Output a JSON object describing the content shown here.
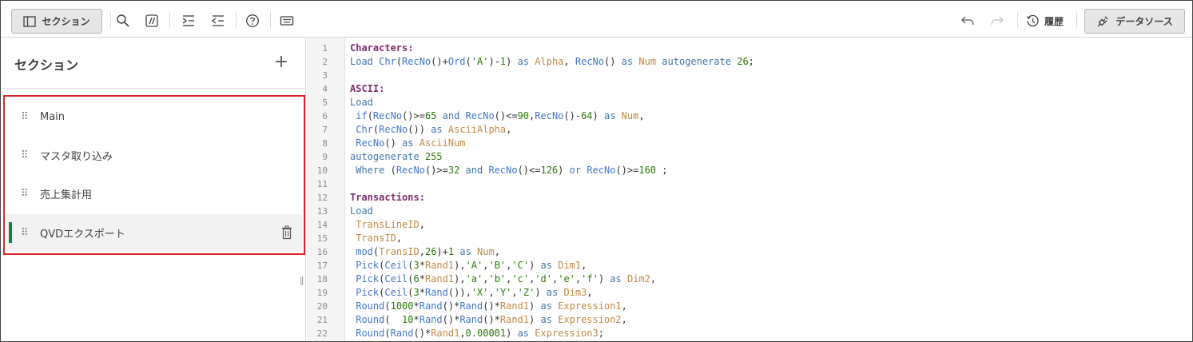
{
  "toolbar": {
    "sections_label": "セクション",
    "history_label": "履歴",
    "datasource_label": "データソース"
  },
  "left_panel": {
    "title": "セクション",
    "add_symbol": "+",
    "sections": [
      {
        "label": "Main"
      },
      {
        "label": "マスタ取り込み"
      },
      {
        "label": "売上集計用"
      },
      {
        "label": "QVDエクスポート",
        "active": true
      }
    ]
  },
  "editor": {
    "line_numbers": [
      "1",
      "2",
      "3",
      "4",
      "5",
      "6",
      "7",
      "8",
      "9",
      "10",
      "11",
      "12",
      "13",
      "14",
      "15",
      "16",
      "17",
      "18",
      "19",
      "20",
      "21",
      "22"
    ],
    "lines": [
      [
        [
          "lbl",
          "Characters:"
        ]
      ],
      [
        [
          "kw",
          "Load "
        ],
        [
          "fn",
          "Chr"
        ],
        [
          "txt",
          "("
        ],
        [
          "fn",
          "RecNo"
        ],
        [
          "txt",
          "()+"
        ],
        [
          "fn",
          "Ord"
        ],
        [
          "txt",
          "("
        ],
        [
          "str",
          "'A'"
        ],
        [
          "txt",
          ")-"
        ],
        [
          "num",
          "1"
        ],
        [
          "txt",
          ") "
        ],
        [
          "kw",
          "as "
        ],
        [
          "fld",
          "Alpha"
        ],
        [
          "txt",
          ", "
        ],
        [
          "fn",
          "RecNo"
        ],
        [
          "txt",
          "() "
        ],
        [
          "kw",
          "as "
        ],
        [
          "fld",
          "Num"
        ],
        [
          "txt",
          " "
        ],
        [
          "kw",
          "autogenerate "
        ],
        [
          "num",
          "26"
        ],
        [
          "txt",
          ";"
        ]
      ],
      [],
      [
        [
          "lbl",
          "ASCII:"
        ]
      ],
      [
        [
          "kw",
          "Load"
        ]
      ],
      [
        [
          "txt",
          " "
        ],
        [
          "fn",
          "if"
        ],
        [
          "txt",
          "("
        ],
        [
          "fn",
          "RecNo"
        ],
        [
          "txt",
          "()>="
        ],
        [
          "num",
          "65"
        ],
        [
          "txt",
          " "
        ],
        [
          "kw",
          "and "
        ],
        [
          "fn",
          "RecNo"
        ],
        [
          "txt",
          "()<="
        ],
        [
          "num",
          "90"
        ],
        [
          "txt",
          ","
        ],
        [
          "fn",
          "RecNo"
        ],
        [
          "txt",
          "()-"
        ],
        [
          "num",
          "64"
        ],
        [
          "txt",
          ") "
        ],
        [
          "kw",
          "as "
        ],
        [
          "fld",
          "Num"
        ],
        [
          "txt",
          ","
        ]
      ],
      [
        [
          "txt",
          " "
        ],
        [
          "fn",
          "Chr"
        ],
        [
          "txt",
          "("
        ],
        [
          "fn",
          "RecNo"
        ],
        [
          "txt",
          "()) "
        ],
        [
          "kw",
          "as "
        ],
        [
          "fld",
          "AsciiAlpha"
        ],
        [
          "txt",
          ","
        ]
      ],
      [
        [
          "txt",
          " "
        ],
        [
          "fn",
          "RecNo"
        ],
        [
          "txt",
          "() "
        ],
        [
          "kw",
          "as "
        ],
        [
          "fld",
          "AsciiNum"
        ]
      ],
      [
        [
          "kw",
          "autogenerate "
        ],
        [
          "num",
          "255"
        ]
      ],
      [
        [
          "txt",
          " "
        ],
        [
          "kw",
          "Where "
        ],
        [
          "txt",
          "("
        ],
        [
          "fn",
          "RecNo"
        ],
        [
          "txt",
          "()>="
        ],
        [
          "num",
          "32"
        ],
        [
          "txt",
          " "
        ],
        [
          "kw",
          "and "
        ],
        [
          "fn",
          "RecNo"
        ],
        [
          "txt",
          "()<="
        ],
        [
          "num",
          "126"
        ],
        [
          "txt",
          ") "
        ],
        [
          "kw",
          "or "
        ],
        [
          "fn",
          "RecNo"
        ],
        [
          "txt",
          "()>="
        ],
        [
          "num",
          "160"
        ],
        [
          "txt",
          " ;"
        ]
      ],
      [],
      [
        [
          "lbl",
          "Transactions:"
        ]
      ],
      [
        [
          "kw",
          "Load"
        ]
      ],
      [
        [
          "txt",
          " "
        ],
        [
          "fld",
          "TransLineID"
        ],
        [
          "txt",
          ","
        ]
      ],
      [
        [
          "txt",
          " "
        ],
        [
          "fld",
          "TransID"
        ],
        [
          "txt",
          ","
        ]
      ],
      [
        [
          "txt",
          " "
        ],
        [
          "fn",
          "mod"
        ],
        [
          "txt",
          "("
        ],
        [
          "fld",
          "TransID"
        ],
        [
          "txt",
          ","
        ],
        [
          "num",
          "26"
        ],
        [
          "txt",
          ")+"
        ],
        [
          "num",
          "1"
        ],
        [
          "txt",
          " "
        ],
        [
          "kw",
          "as "
        ],
        [
          "fld",
          "Num"
        ],
        [
          "txt",
          ","
        ]
      ],
      [
        [
          "txt",
          " "
        ],
        [
          "fn",
          "Pick"
        ],
        [
          "txt",
          "("
        ],
        [
          "fn",
          "Ceil"
        ],
        [
          "txt",
          "("
        ],
        [
          "num",
          "3"
        ],
        [
          "txt",
          "*"
        ],
        [
          "fld",
          "Rand1"
        ],
        [
          "txt",
          "),"
        ],
        [
          "str",
          "'A'"
        ],
        [
          "txt",
          ","
        ],
        [
          "str",
          "'B'"
        ],
        [
          "txt",
          ","
        ],
        [
          "str",
          "'C'"
        ],
        [
          "txt",
          ") "
        ],
        [
          "kw",
          "as "
        ],
        [
          "fld",
          "Dim1"
        ],
        [
          "txt",
          ","
        ]
      ],
      [
        [
          "txt",
          " "
        ],
        [
          "fn",
          "Pick"
        ],
        [
          "txt",
          "("
        ],
        [
          "fn",
          "Ceil"
        ],
        [
          "txt",
          "("
        ],
        [
          "num",
          "6"
        ],
        [
          "txt",
          "*"
        ],
        [
          "fld",
          "Rand1"
        ],
        [
          "txt",
          "),"
        ],
        [
          "str",
          "'a'"
        ],
        [
          "txt",
          ","
        ],
        [
          "str",
          "'b'"
        ],
        [
          "txt",
          ","
        ],
        [
          "str",
          "'c'"
        ],
        [
          "txt",
          ","
        ],
        [
          "str",
          "'d'"
        ],
        [
          "txt",
          ","
        ],
        [
          "str",
          "'e'"
        ],
        [
          "txt",
          ","
        ],
        [
          "str",
          "'f'"
        ],
        [
          "txt",
          ") "
        ],
        [
          "kw",
          "as "
        ],
        [
          "fld",
          "Dim2"
        ],
        [
          "txt",
          ","
        ]
      ],
      [
        [
          "txt",
          " "
        ],
        [
          "fn",
          "Pick"
        ],
        [
          "txt",
          "("
        ],
        [
          "fn",
          "Ceil"
        ],
        [
          "txt",
          "("
        ],
        [
          "num",
          "3"
        ],
        [
          "txt",
          "*"
        ],
        [
          "fn",
          "Rand"
        ],
        [
          "txt",
          "()),"
        ],
        [
          "str",
          "'X'"
        ],
        [
          "txt",
          ","
        ],
        [
          "str",
          "'Y'"
        ],
        [
          "txt",
          ","
        ],
        [
          "str",
          "'Z'"
        ],
        [
          "txt",
          ") "
        ],
        [
          "kw",
          "as "
        ],
        [
          "fld",
          "Dim3"
        ],
        [
          "txt",
          ","
        ]
      ],
      [
        [
          "txt",
          " "
        ],
        [
          "fn",
          "Round"
        ],
        [
          "txt",
          "("
        ],
        [
          "num",
          "1000"
        ],
        [
          "txt",
          "*"
        ],
        [
          "fn",
          "Rand"
        ],
        [
          "txt",
          "()*"
        ],
        [
          "fn",
          "Rand"
        ],
        [
          "txt",
          "()*"
        ],
        [
          "fld",
          "Rand1"
        ],
        [
          "txt",
          ") "
        ],
        [
          "kw",
          "as "
        ],
        [
          "fld",
          "Expression1"
        ],
        [
          "txt",
          ","
        ]
      ],
      [
        [
          "txt",
          " "
        ],
        [
          "fn",
          "Round"
        ],
        [
          "txt",
          "(  "
        ],
        [
          "num",
          "10"
        ],
        [
          "txt",
          "*"
        ],
        [
          "fn",
          "Rand"
        ],
        [
          "txt",
          "()*"
        ],
        [
          "fn",
          "Rand"
        ],
        [
          "txt",
          "()*"
        ],
        [
          "fld",
          "Rand1"
        ],
        [
          "txt",
          ") "
        ],
        [
          "kw",
          "as "
        ],
        [
          "fld",
          "Expression2"
        ],
        [
          "txt",
          ","
        ]
      ],
      [
        [
          "txt",
          " "
        ],
        [
          "fn",
          "Round"
        ],
        [
          "txt",
          "("
        ],
        [
          "fn",
          "Rand"
        ],
        [
          "txt",
          "()*"
        ],
        [
          "fld",
          "Rand1"
        ],
        [
          "txt",
          ","
        ],
        [
          "num",
          "0.00001"
        ],
        [
          "txt",
          ") "
        ],
        [
          "kw",
          "as "
        ],
        [
          "fld",
          "Expression3"
        ],
        [
          "txt",
          ";"
        ]
      ]
    ]
  }
}
